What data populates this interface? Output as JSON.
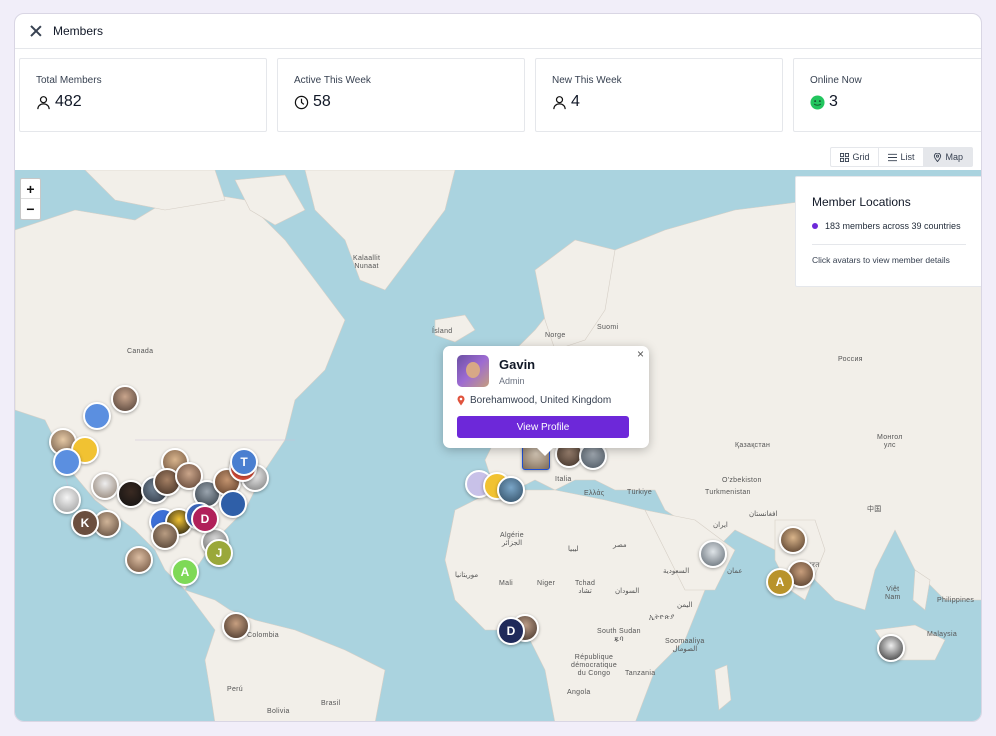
{
  "window": {
    "title": "Members"
  },
  "stats": [
    {
      "label": "Total Members",
      "value": "482",
      "icon": "user-icon"
    },
    {
      "label": "Active This Week",
      "value": "58",
      "icon": "clock-icon"
    },
    {
      "label": "New This Week",
      "value": "4",
      "icon": "user-plus-icon"
    },
    {
      "label": "Online Now",
      "value": "3",
      "icon": "online-smile-icon"
    }
  ],
  "view_toggle": {
    "grid": "Grid",
    "list": "List",
    "map": "Map",
    "active": "Map"
  },
  "zoom": {
    "in": "+",
    "out": "−"
  },
  "map_labels": {
    "kalaallit": "Kalaallit\nNunaat",
    "canada": "Canada",
    "island": "Ísland",
    "suomi": "Suomi",
    "norge": "Norge",
    "rossiya": "Россия",
    "kazakhstan": "Қазақстан",
    "mongolia": "Монгол\nулс",
    "uzbekistan": "O'zbekiston",
    "turkmenistan": "Turkmenistan",
    "turkiye": "Türkiye",
    "ellada": "Ελλάς",
    "italia": "Italia",
    "algerie": "Algérie\nالجزائر",
    "libya": "ليبيا",
    "misr": "مصر",
    "mauritanie": "موريتانيا",
    "mali": "Mali",
    "niger": "Niger",
    "tchad": "Tchad\nتشاد",
    "sudan": "السودان",
    "saudi": "السعودية",
    "yemen": "اليمن",
    "ethiopia": "ኢትዮጵያ",
    "south_sudan": "South Sudan\nጁባ",
    "somaliland": "Soomaaliya\nالصومال",
    "oman": "عمان",
    "iran": "ایران",
    "afghanistan": "افغانستان",
    "india": "भारत",
    "zhongguo": "中国",
    "vietnam": "Việt\nNam",
    "philippines": "Philippines",
    "malaysia": "Malaysia",
    "rdc": "République\ndémocratique\ndu Congo",
    "angola": "Angola",
    "tanzania": "Tanzania",
    "colombia": "Colombia",
    "peru": "Perú",
    "brasil": "Brasil",
    "bolivia": "Bolivia"
  },
  "legend": {
    "title": "Member Locations",
    "summary": "183 members across 39 countries",
    "hint": "Click avatars to view member details"
  },
  "popup": {
    "name": "Gavin",
    "role": "Admin",
    "location": "Borehamwood, United Kingdom",
    "button": "View Profile",
    "close": "×"
  },
  "avatars": [
    {
      "letter": "T",
      "color": "#4a7fd0"
    },
    {
      "letter": "K",
      "color": "#6b4f3f"
    },
    {
      "letter": "D",
      "color": "#b0205a"
    },
    {
      "letter": "J",
      "color": "#9aa83a"
    },
    {
      "letter": "A",
      "color": "#7ed957"
    },
    {
      "letter": "D",
      "color": "#1f2a5a"
    },
    {
      "letter": "A",
      "color": "#b8932b"
    }
  ],
  "colors": {
    "accent": "#6d28d9",
    "water": "#aad3df",
    "land": "#f2efe9"
  }
}
